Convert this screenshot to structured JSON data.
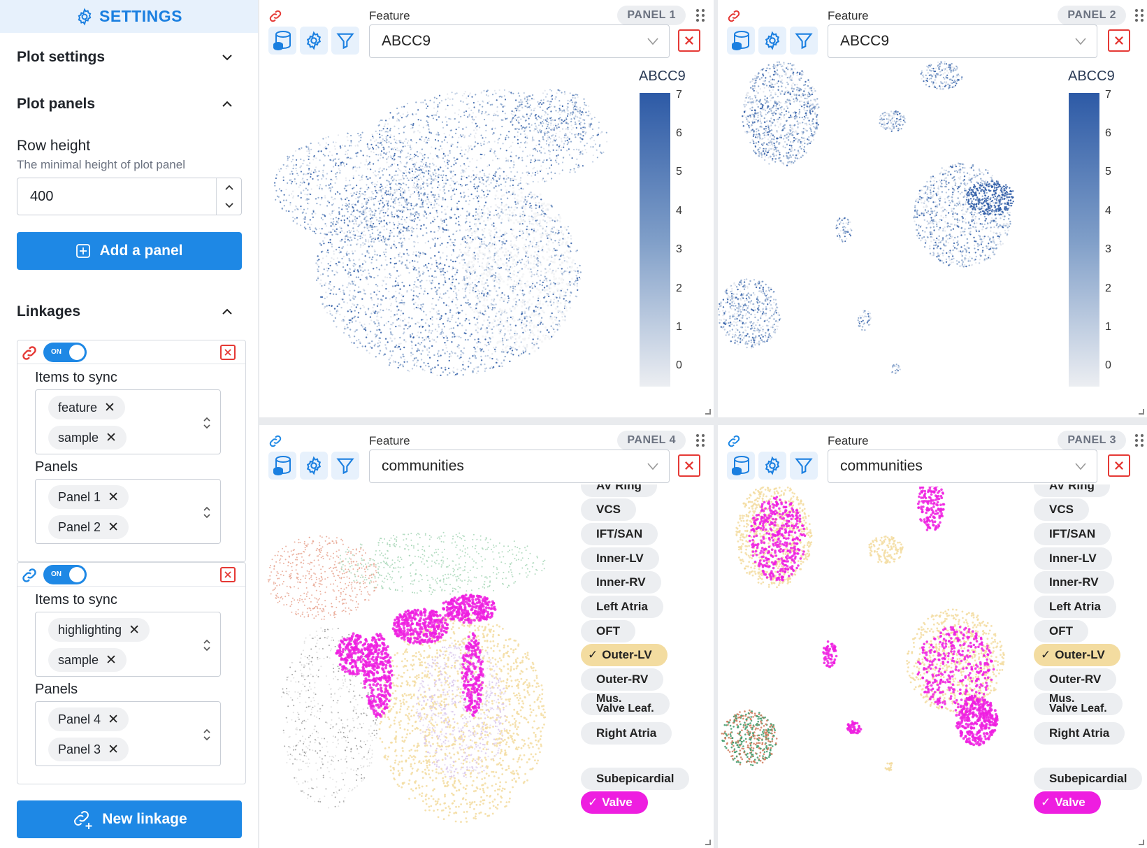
{
  "sidebar": {
    "header": "SETTINGS",
    "plot_settings": "Plot settings",
    "plot_panels": "Plot panels",
    "row_height": {
      "label": "Row height",
      "description": "The minimal height of plot panel",
      "value": "400"
    },
    "add_panel": "Add a panel",
    "linkages_title": "Linkages",
    "linkages": [
      {
        "toggle": "ON",
        "items_label": "Items to sync",
        "items": [
          "feature",
          "sample"
        ],
        "panels_label": "Panels",
        "panels": [
          "Panel 1",
          "Panel 2"
        ]
      },
      {
        "toggle": "ON",
        "items_label": "Items to sync",
        "items": [
          "highlighting",
          "sample"
        ],
        "panels_label": "Panels",
        "panels": [
          "Panel 4",
          "Panel 3"
        ]
      }
    ],
    "new_linkage": "New linkage"
  },
  "panels": [
    {
      "badge": "PANEL 1",
      "feature_label": "Feature",
      "feature": "ABCC9",
      "colorbar_title": "ABCC9",
      "ticks": [
        "7",
        "6",
        "5",
        "4",
        "3",
        "2",
        "1",
        "0"
      ]
    },
    {
      "badge": "PANEL 2",
      "feature_label": "Feature",
      "feature": "ABCC9",
      "colorbar_title": "ABCC9",
      "ticks": [
        "7",
        "6",
        "5",
        "4",
        "3",
        "2",
        "1",
        "0"
      ]
    },
    {
      "badge": "PANEL 4",
      "feature_label": "Feature",
      "feature": "communities"
    },
    {
      "badge": "PANEL 3",
      "feature_label": "Feature",
      "feature": "communities"
    }
  ],
  "legend": {
    "items": [
      "AV Ring",
      "VCS",
      "IFT/SAN",
      "Inner-LV",
      "Inner-RV",
      "Left Atria",
      "OFT",
      "Outer-LV",
      "Outer-RV",
      "Mus.",
      "Valve Leaf.",
      "Right Atria",
      "Subepicardial",
      "Valve"
    ],
    "selected": [
      "Outer-LV",
      "Valve"
    ]
  },
  "colors": {
    "accent": "#1e88e5",
    "highlight": "#ee1ee0",
    "selected": "#f3dca0",
    "close": "#e53935"
  }
}
